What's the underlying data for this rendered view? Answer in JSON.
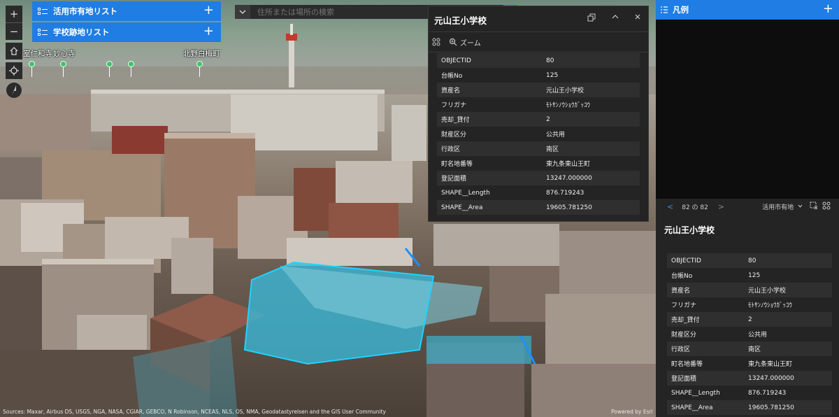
{
  "lists": [
    {
      "label": "活用市有地リスト"
    },
    {
      "label": "学校跡地リスト"
    }
  ],
  "nav": {
    "zoom_in": "+",
    "zoom_out": "−",
    "home_icon": "home-icon",
    "locate_icon": "locate-icon",
    "compass_icon": "compass-icon"
  },
  "search": {
    "placeholder": "住所または場所の検索"
  },
  "places": [
    {
      "label": "室仁和寺"
    },
    {
      "label": "妙心寺"
    },
    {
      "label": "北野白梅町"
    }
  ],
  "popup": {
    "title": "元山王小学校",
    "zoom_label": "ズーム",
    "attributes": [
      {
        "key": "OBJECTID",
        "value": "80"
      },
      {
        "key": "台帳No",
        "value": "125"
      },
      {
        "key": "資産名",
        "value": "元山王小学校"
      },
      {
        "key": "フリガナ",
        "value": "ﾓﾄｻﾝﾉｳｼｮｳｶﾞｯｺｳ"
      },
      {
        "key": "売却_貸付",
        "value": "2"
      },
      {
        "key": "財産区分",
        "value": "公共用"
      },
      {
        "key": "行政区",
        "value": "南区"
      },
      {
        "key": "町名地番等",
        "value": "東九条東山王町"
      },
      {
        "key": "登記面積",
        "value": "13247.000000"
      },
      {
        "key": "SHAPE__Length",
        "value": "876.719243"
      },
      {
        "key": "SHAPE__Area",
        "value": "19605.781250"
      }
    ]
  },
  "legend": {
    "title": "凡例"
  },
  "feature_nav": {
    "counter": "82 の 82",
    "layer": "活用市有地"
  },
  "feature": {
    "title": "元山王小学校",
    "attributes": [
      {
        "key": "OBJECTID",
        "value": "80"
      },
      {
        "key": "台帳No",
        "value": "125"
      },
      {
        "key": "資産名",
        "value": "元山王小学校"
      },
      {
        "key": "フリガナ",
        "value": "ﾓﾄｻﾝﾉｳｼｮｳｶﾞｯｺｳ"
      },
      {
        "key": "売却_貸付",
        "value": "2"
      },
      {
        "key": "財産区分",
        "value": "公共用"
      },
      {
        "key": "行政区",
        "value": "南区"
      },
      {
        "key": "町名地番等",
        "value": "東九条東山王町"
      },
      {
        "key": "登記面積",
        "value": "13247.000000"
      },
      {
        "key": "SHAPE__Length",
        "value": "876.719243"
      },
      {
        "key": "SHAPE__Area",
        "value": "19605.781250"
      }
    ]
  },
  "footer": {
    "attribution": "Sources: Maxar, Airbus DS, USGS, NGA, NASA, CGIAR, GEBCO, N Robinson, NCEAS, NLS, OS, NMA, Geodatastyrelsen and the GIS User Community",
    "powered": "Powered by Esri"
  },
  "colors": {
    "accent": "#1f7de3",
    "panel": "#242424",
    "highlight": "#39b8d8"
  }
}
